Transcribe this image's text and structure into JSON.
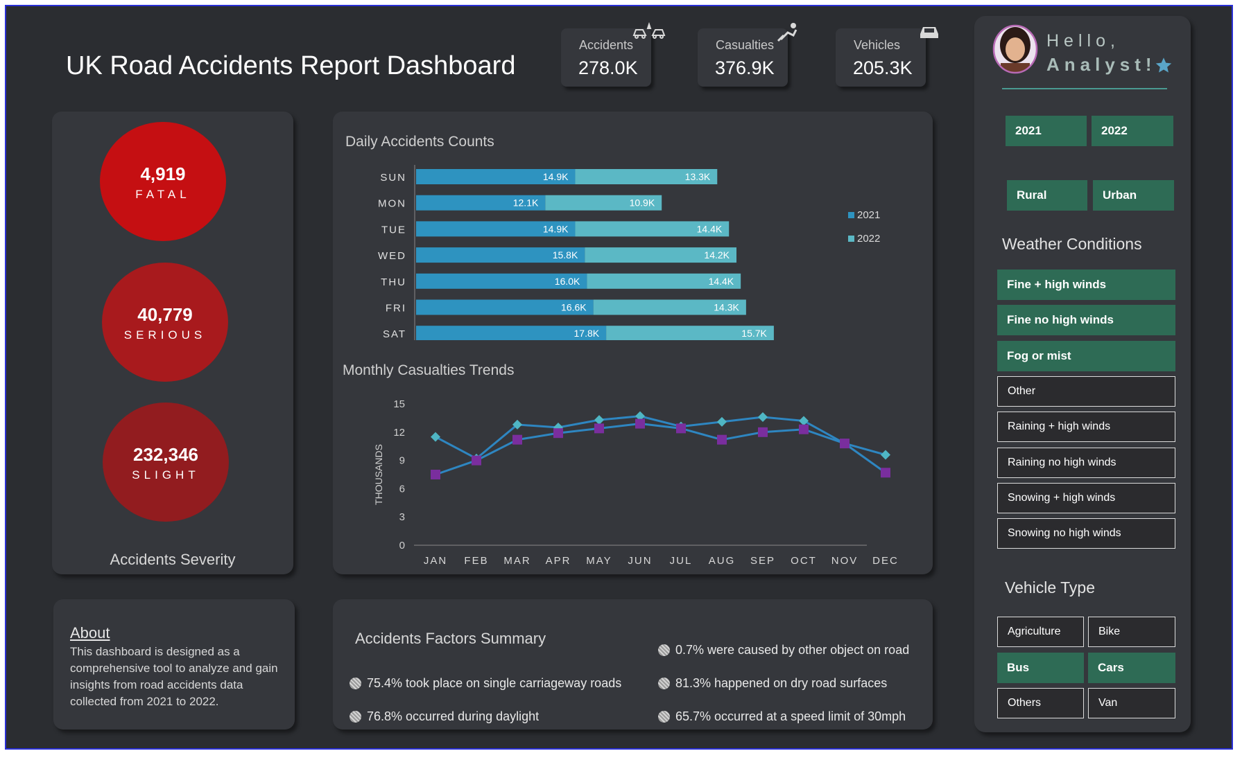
{
  "header": {
    "title": "UK Road Accidents Report Dashboard",
    "kpis": [
      {
        "label": "Accidents",
        "value": "278.0K",
        "icon": "car-crash-icon"
      },
      {
        "label": "Casualties",
        "value": "376.9K",
        "icon": "injured-person-icon"
      },
      {
        "label": "Vehicles",
        "value": "205.3K",
        "icon": "car-icon"
      }
    ]
  },
  "severity": {
    "title": "Accidents Severity",
    "items": [
      {
        "value": "4,919",
        "label": "FATAL",
        "color": "#c50f12"
      },
      {
        "value": "40,779",
        "label": "SERIOUS",
        "color": "#a81a1d"
      },
      {
        "value": "232,346",
        "label": "SLIGHT",
        "color": "#921c1f"
      }
    ]
  },
  "about": {
    "title": "About",
    "text": "This dashboard is designed as a comprehensive tool to analyze and gain insights from road accidents data collected from 2021 to 2022."
  },
  "chart_data": [
    {
      "type": "bar",
      "stacked": true,
      "orientation": "horizontal",
      "title": "Daily Accidents Counts",
      "categories": [
        "SUN",
        "MON",
        "TUE",
        "WED",
        "THU",
        "FRI",
        "SAT"
      ],
      "series": [
        {
          "name": "2021",
          "values": [
            14.9,
            12.1,
            14.9,
            15.8,
            16.0,
            16.6,
            17.8
          ],
          "labels": [
            "14.9K",
            "12.1K",
            "14.9K",
            "15.8K",
            "16.0K",
            "16.6K",
            "17.8K"
          ],
          "color": "#2e93c0"
        },
        {
          "name": "2022",
          "values": [
            13.3,
            10.9,
            14.4,
            14.2,
            14.4,
            14.3,
            15.7
          ],
          "labels": [
            "13.3K",
            "10.9K",
            "14.4K",
            "14.2K",
            "14.4K",
            "14.3K",
            "15.7K"
          ],
          "color": "#5bb8c5"
        }
      ],
      "legend": "right",
      "unit": "K"
    },
    {
      "type": "line",
      "title": "Monthly Casualties Trends",
      "ylabel": "THOUSANDS",
      "categories": [
        "JAN",
        "FEB",
        "MAR",
        "APR",
        "MAY",
        "JUN",
        "JUL",
        "AUG",
        "SEP",
        "OCT",
        "NOV",
        "DEC"
      ],
      "yticks": [
        0,
        3,
        6,
        9,
        12,
        15
      ],
      "ylim": [
        0,
        15
      ],
      "series": [
        {
          "marker": "diamond",
          "color": "#4fb6c4",
          "values": [
            11.5,
            9.2,
            12.8,
            12.5,
            13.3,
            13.7,
            12.6,
            13.1,
            13.6,
            13.2,
            10.8,
            9.6
          ]
        },
        {
          "marker": "square",
          "color": "#7a2e9e",
          "values": [
            7.5,
            9.0,
            11.2,
            11.9,
            12.4,
            12.9,
            12.4,
            11.2,
            12.0,
            12.3,
            10.8,
            7.7
          ]
        }
      ]
    }
  ],
  "factors": {
    "title": "Accidents Factors Summary",
    "left": [
      "75.4% took place on single carriageway roads",
      "76.8% occurred during daylight"
    ],
    "right": [
      "0.7% were caused by other object on road",
      "81.3% happened  on dry road surfaces",
      "65.7% occurred at a speed limit of 30mph"
    ]
  },
  "sidebar": {
    "greeting_line1": "Hello,",
    "greeting_line2": "Analyst!",
    "years": [
      "2021",
      "2022"
    ],
    "areas": [
      "Rural",
      "Urban"
    ],
    "weather_title": "Weather Conditions",
    "weather": [
      {
        "label": "Fine + high winds",
        "active": true
      },
      {
        "label": "Fine no high winds",
        "active": true
      },
      {
        "label": "Fog or mist",
        "active": true
      },
      {
        "label": "Other",
        "active": false
      },
      {
        "label": "Raining + high winds",
        "active": false
      },
      {
        "label": "Raining no high winds",
        "active": false
      },
      {
        "label": "Snowing + high winds",
        "active": false
      },
      {
        "label": "Snowing no high winds",
        "active": false
      }
    ],
    "vehicle_title": "Vehicle Type",
    "vehicles": [
      {
        "label": "Agriculture",
        "active": false
      },
      {
        "label": "Bike",
        "active": false
      },
      {
        "label": "Bus",
        "active": true
      },
      {
        "label": "Cars",
        "active": true
      },
      {
        "label": "Others",
        "active": false
      },
      {
        "label": "Van",
        "active": false
      }
    ]
  }
}
